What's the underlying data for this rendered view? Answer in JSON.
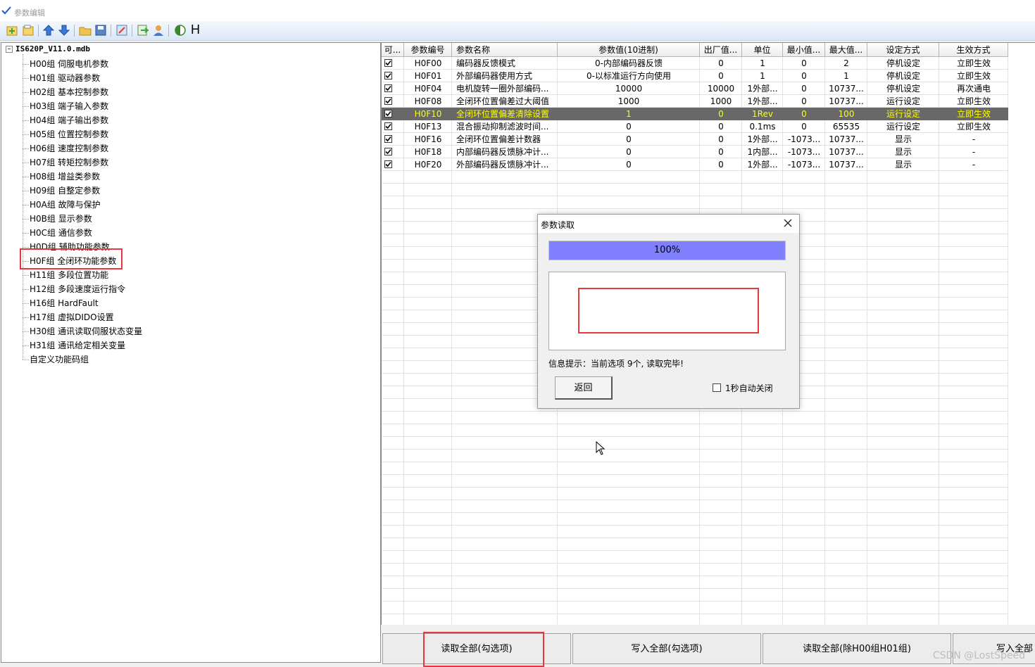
{
  "window": {
    "title": "参数编辑"
  },
  "toolbar": {
    "icons": [
      "new-icon",
      "open-folder-icon",
      "arrow-up-icon",
      "arrow-down-icon",
      "folder-icon",
      "save-icon",
      "edit-icon",
      "export-icon",
      "user-icon",
      "contrast-icon"
    ],
    "h_label": "H"
  },
  "tree": {
    "root": "IS620P_V11.0.mdb",
    "items": [
      "H00组 伺服电机参数",
      "H01组 驱动器参数",
      "H02组 基本控制参数",
      "H03组 端子输入参数",
      "H04组 端子输出参数",
      "H05组 位置控制参数",
      "H06组 速度控制参数",
      "H07组 转矩控制参数",
      "H08组 增益类参数",
      "H09组 自整定参数",
      "H0A组 故障与保护",
      "H0B组 显示参数",
      "H0C组 通信参数",
      "H0D组 辅助功能参数",
      "H0F组 全闭环功能参数",
      "H11组 多段位置功能",
      "H12组 多段速度运行指令",
      "H16组 HardFault",
      "H17组 虚拟DIDO设置",
      "H30组 通讯读取伺服状态变量",
      "H31组 通讯给定相关变量",
      "自定义功能码组"
    ],
    "highlighted_index": 14
  },
  "grid": {
    "headers": [
      "可...",
      "参数编号",
      "参数名称",
      "参数值(10进制)",
      "出厂值...",
      "单位",
      "最小值...",
      "最大值...",
      "设定方式",
      "生效方式"
    ],
    "rows": [
      {
        "checked": true,
        "code": "H0F00",
        "name": "编码器反馈模式",
        "value": "0-内部编码器反馈",
        "default": "0",
        "unit": "1",
        "min": "0",
        "max": "2",
        "set": "停机设定",
        "effect": "立即生效"
      },
      {
        "checked": true,
        "code": "H0F01",
        "name": "外部编码器使用方式",
        "value": "0-以标准运行方向使用",
        "default": "0",
        "unit": "1",
        "min": "0",
        "max": "1",
        "set": "停机设定",
        "effect": "立即生效"
      },
      {
        "checked": true,
        "code": "H0F04",
        "name": "电机旋转一圈外部编码...",
        "value": "10000",
        "default": "10000",
        "unit": "1外部...",
        "min": "0",
        "max": "10737...",
        "set": "停机设定",
        "effect": "再次通电"
      },
      {
        "checked": true,
        "code": "H0F08",
        "name": "全闭环位置偏差过大阈值",
        "value": "1000",
        "default": "1000",
        "unit": "1外部...",
        "min": "0",
        "max": "10737...",
        "set": "运行设定",
        "effect": "立即生效"
      },
      {
        "checked": true,
        "code": "H0F10",
        "name": "全闭环位置偏差清除设置",
        "value": "1",
        "default": "0",
        "unit": "1Rev",
        "min": "0",
        "max": "100",
        "set": "运行设定",
        "effect": "立即生效",
        "selected": true
      },
      {
        "checked": true,
        "code": "H0F13",
        "name": "混合振动抑制滤波时间...",
        "value": "0",
        "default": "0",
        "unit": "0.1ms",
        "min": "0",
        "max": "65535",
        "set": "运行设定",
        "effect": "立即生效"
      },
      {
        "checked": true,
        "code": "H0F16",
        "name": "全闭环位置偏差计数器",
        "value": "0",
        "default": "0",
        "unit": "1外部...",
        "min": "-1073...",
        "max": "10737...",
        "set": "显示",
        "effect": "-"
      },
      {
        "checked": true,
        "code": "H0F18",
        "name": "内部编码器反馈脉冲计...",
        "value": "0",
        "default": "0",
        "unit": "1内部...",
        "min": "-1073...",
        "max": "10737...",
        "set": "显示",
        "effect": "-"
      },
      {
        "checked": true,
        "code": "H0F20",
        "name": "外部编码器反馈脉冲计...",
        "value": "0",
        "default": "0",
        "unit": "1外部...",
        "min": "-1073...",
        "max": "10737...",
        "set": "显示",
        "effect": "-"
      }
    ]
  },
  "bottom_buttons": [
    "读取全部(勾选项)",
    "写入全部(勾选项)",
    "读取全部(除H00组H01组)",
    "写入全部"
  ],
  "watermark": "CSDN @LostSpeed",
  "dialog": {
    "title": "参数读取",
    "progress_percent": 100,
    "progress_text": "100%",
    "info": "信息提示：当前选项 9个, 读取完毕!",
    "back_label": "返回",
    "auto_close_label": "1秒自动关闭",
    "auto_close_checked": false
  },
  "colors": {
    "progress_fill": "#8080ff",
    "selected_row_bg": "#686868",
    "selected_row_text": "#ffff00",
    "highlight_box": "#e8373b"
  }
}
